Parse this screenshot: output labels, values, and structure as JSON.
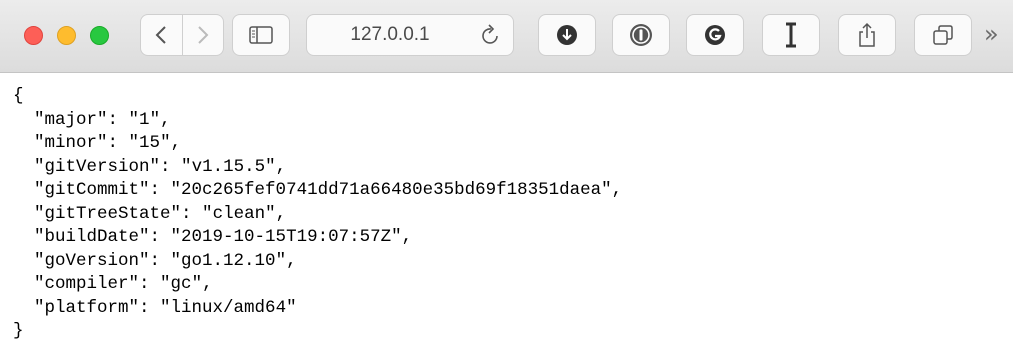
{
  "browser": {
    "address": "127.0.0.1",
    "icons": {
      "close": "close-window-icon",
      "minimize": "minimize-window-icon",
      "zoom": "zoom-window-icon",
      "back": "chevron-left-icon",
      "forward": "chevron-right-icon",
      "sidebar": "sidebar-icon",
      "reload": "reload-icon",
      "download": "download-icon",
      "password": "password-manager-icon",
      "grammarly": "grammarly-icon",
      "instapaper": "instapaper-icon",
      "share": "share-icon",
      "tabs": "tabs-overview-icon",
      "more": "more-toolbar-icon"
    },
    "colors": {
      "close": "#fd5f57",
      "minimize": "#febc2e",
      "zoom": "#28c840"
    },
    "overflow_glyph": "»"
  },
  "json_view": {
    "open_brace": "{",
    "close_brace": "}",
    "entries": [
      {
        "key": "major",
        "value": "1"
      },
      {
        "key": "minor",
        "value": "15"
      },
      {
        "key": "gitVersion",
        "value": "v1.15.5"
      },
      {
        "key": "gitCommit",
        "value": "20c265fef0741dd71a66480e35bd69f18351daea"
      },
      {
        "key": "gitTreeState",
        "value": "clean"
      },
      {
        "key": "buildDate",
        "value": "2019-10-15T19:07:57Z"
      },
      {
        "key": "goVersion",
        "value": "go1.12.10"
      },
      {
        "key": "compiler",
        "value": "gc"
      },
      {
        "key": "platform",
        "value": "linux/amd64"
      }
    ]
  }
}
